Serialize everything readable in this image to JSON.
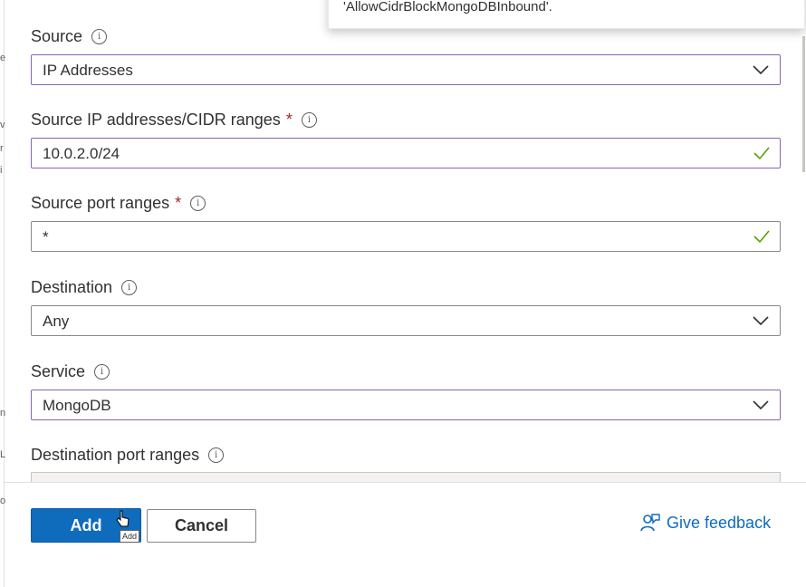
{
  "tooltip": {
    "text": "'AllowCidrBlockMongoDBInbound'."
  },
  "source": {
    "label": "Source",
    "value": "IP Addresses"
  },
  "source_ip": {
    "label": "Source IP addresses/CIDR ranges",
    "required": "*",
    "value": "10.0.2.0/24"
  },
  "source_port": {
    "label": "Source port ranges",
    "required": "*",
    "value": "*"
  },
  "destination": {
    "label": "Destination",
    "value": "Any"
  },
  "service": {
    "label": "Service",
    "value": "MongoDB"
  },
  "dest_port": {
    "label": "Destination port ranges"
  },
  "footer": {
    "add_label": "Add",
    "cancel_label": "Cancel",
    "add_tooltip": "Add",
    "feedback_label": "Give feedback"
  },
  "colors": {
    "primary": "#0f6cbd",
    "valid": "#57a300",
    "required": "#a4262c",
    "focus": "#8764b8"
  },
  "icons": {
    "info": "info-icon",
    "chevron": "chevron-down-icon",
    "check": "checkmark-icon",
    "feedback": "feedback-person-icon"
  }
}
